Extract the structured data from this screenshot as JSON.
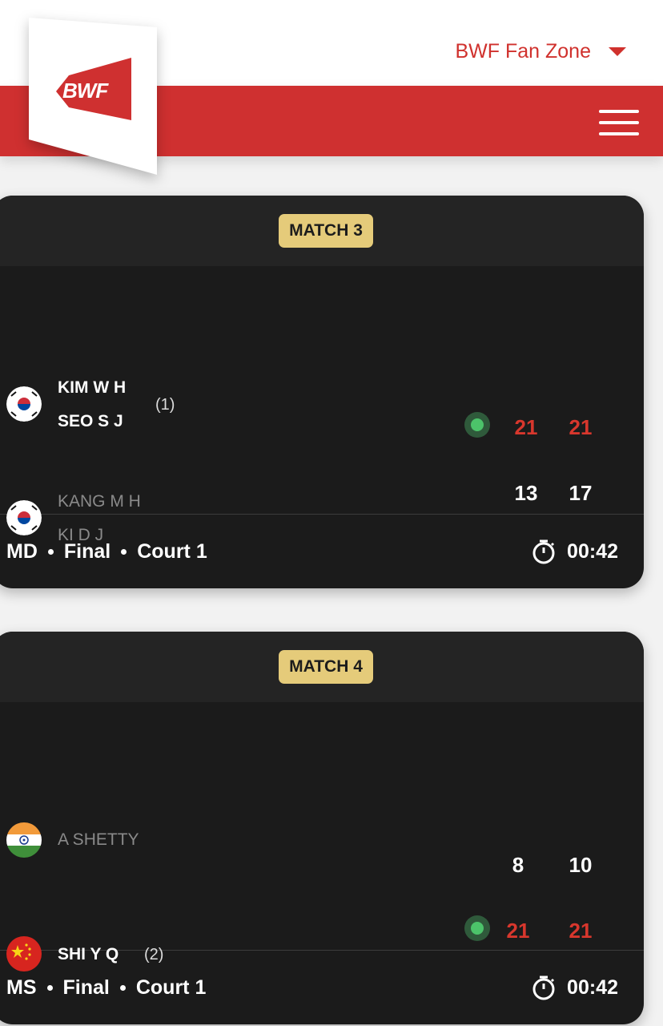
{
  "header": {
    "fan_zone_label": "BWF Fan Zone",
    "logo_text": "BWF"
  },
  "colors": {
    "brand_red": "#cf3030",
    "badge_gold": "#e5cb7a",
    "card_bg": "#1b1b1b",
    "live_green": "#4cc36a"
  },
  "matches": [
    {
      "badge": "MATCH 3",
      "team1": {
        "players": [
          "KIM W H",
          "SEO S J"
        ],
        "seed": "(1)",
        "flag": "korea",
        "scores": [
          "21",
          "21"
        ],
        "winner": true
      },
      "team2": {
        "players": [
          "KANG M H",
          "KI D J"
        ],
        "flag": "korea",
        "scores": [
          "13",
          "17"
        ],
        "winner": false
      },
      "event": "MD",
      "round": "Final",
      "court": "Court 1",
      "duration": "00:42"
    },
    {
      "badge": "MATCH 4",
      "team1": {
        "players": [
          "A SHETTY"
        ],
        "flag": "india",
        "scores": [
          "8",
          "10"
        ],
        "winner": false
      },
      "team2": {
        "players": [
          "SHI Y Q"
        ],
        "seed": "(2)",
        "flag": "china",
        "scores": [
          "21",
          "21"
        ],
        "winner": true
      },
      "event": "MS",
      "round": "Final",
      "court": "Court 1",
      "duration": "00:42"
    }
  ]
}
